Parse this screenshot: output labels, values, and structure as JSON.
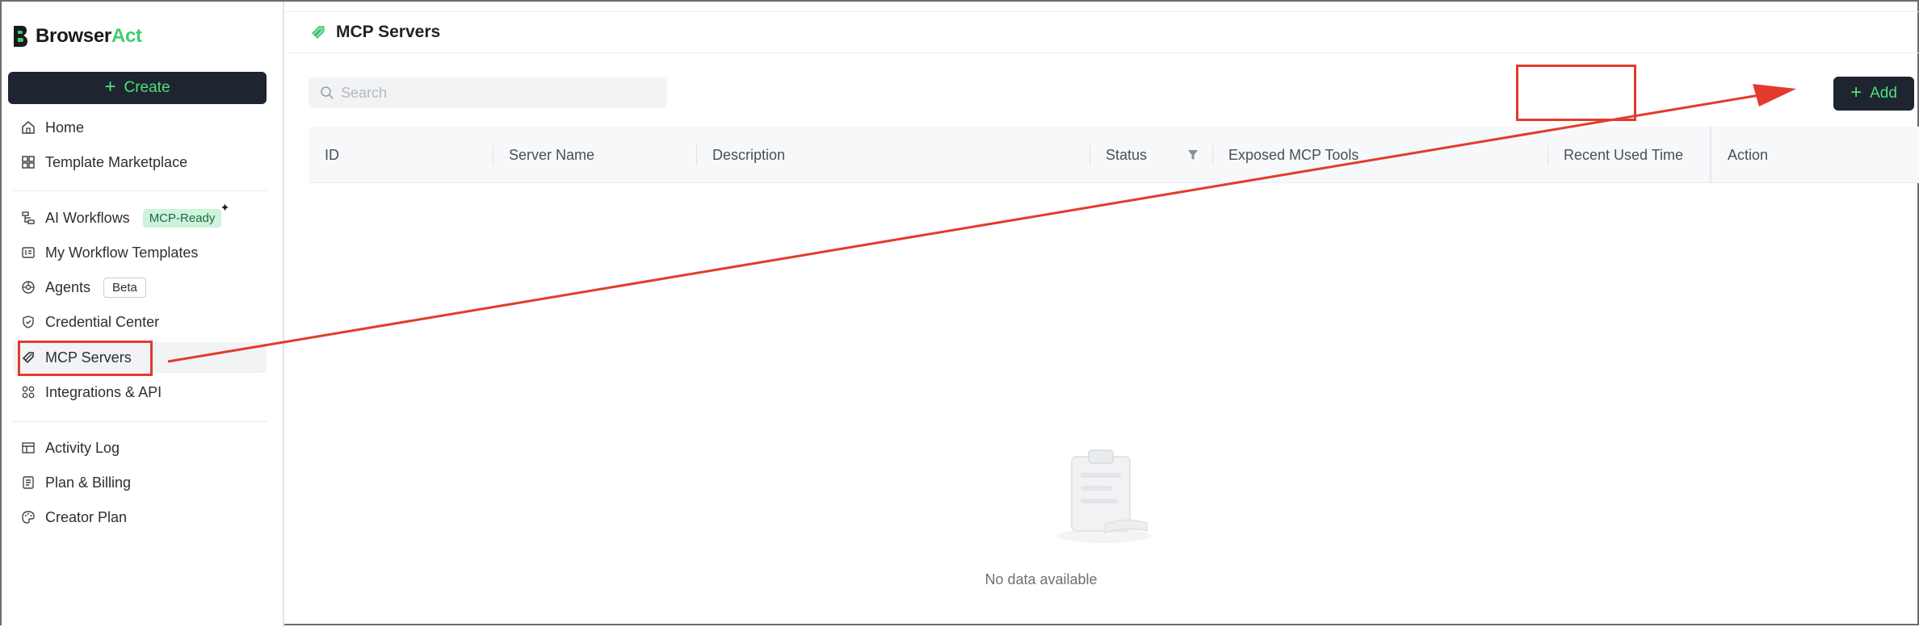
{
  "app": {
    "brand_prefix": "Browser",
    "brand_accent": "Act",
    "accent_color": "#3ecf6a",
    "dark_button_color": "#1e2430"
  },
  "sidebar": {
    "create_label": "Create",
    "items": [
      {
        "label": "Home",
        "icon": "home-icon"
      },
      {
        "label": "Template Marketplace",
        "icon": "marketplace-icon"
      },
      {
        "label": "AI Workflows",
        "icon": "workflow-icon",
        "badge": "MCP-Ready"
      },
      {
        "label": "My Workflow Templates",
        "icon": "template-icon"
      },
      {
        "label": "Agents",
        "icon": "agent-icon",
        "badge": "Beta"
      },
      {
        "label": "Credential Center",
        "icon": "shield-icon"
      },
      {
        "label": "MCP Servers",
        "icon": "mcp-icon",
        "active": true
      },
      {
        "label": "Integrations & API",
        "icon": "integrations-icon"
      },
      {
        "label": "Activity Log",
        "icon": "activity-log-icon"
      },
      {
        "label": "Plan & Billing",
        "icon": "billing-icon"
      },
      {
        "label": "Creator Plan",
        "icon": "palette-icon"
      }
    ]
  },
  "main": {
    "page_title": "MCP Servers",
    "search_placeholder": "Search",
    "add_label": "Add",
    "columns": [
      "ID",
      "Server Name",
      "Description",
      "Status",
      "Exposed MCP Tools",
      "Recent Used Time",
      "Action"
    ],
    "empty_text": "No data available"
  },
  "annotation": {
    "color": "#e23b2e"
  }
}
